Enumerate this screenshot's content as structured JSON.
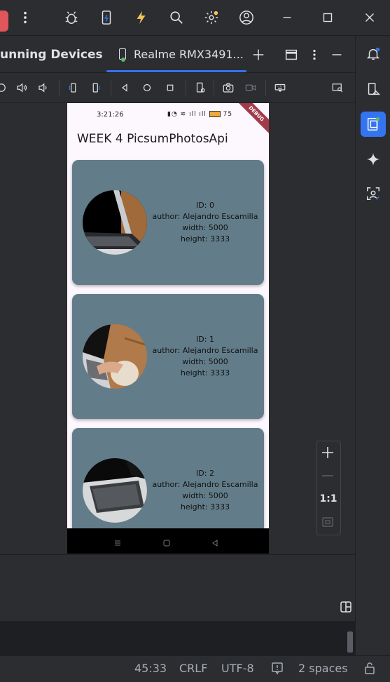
{
  "tool_window": {
    "title": "unning Devices",
    "tab_label": "Realme RMX3491..."
  },
  "device": {
    "status_time": "3:21:26",
    "status_battery": "75",
    "debug_banner": "DEBUG",
    "app_title": "WEEK 4 PicsumPhotosApi",
    "cards": [
      {
        "id": "ID: 0",
        "author": "author: Alejandro Escamilla",
        "width": "width: 5000",
        "height": "height: 3333"
      },
      {
        "id": "ID: 1",
        "author": "author: Alejandro Escamilla",
        "width": "width: 5000",
        "height": "height: 3333"
      },
      {
        "id": "ID: 2",
        "author": "author: Alejandro Escamilla",
        "width": "width: 5000",
        "height": "height: 3333"
      }
    ]
  },
  "zoom": {
    "one_to_one": "1:1"
  },
  "statusbar": {
    "position": "45:33",
    "line_sep": "CRLF",
    "encoding": "UTF-8",
    "indent": "2 spaces"
  },
  "colors": {
    "accent": "#3574f0",
    "card": "#627d89",
    "lightning": "#f2c55c",
    "notification_dot": "#f2c55c"
  }
}
